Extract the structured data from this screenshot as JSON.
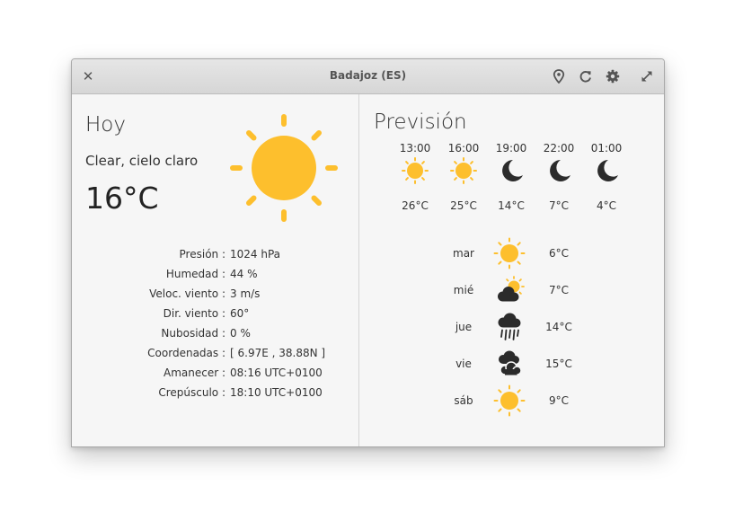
{
  "window": {
    "title": "Badajoz (ES)"
  },
  "titlebar_icons": [
    "close-icon",
    "location-pin-icon",
    "refresh-icon",
    "gear-icon",
    "maximize-icon"
  ],
  "colors": {
    "sun": "#FDBF2D",
    "dark_icon": "#2b2b2b"
  },
  "today": {
    "heading": "Hoy",
    "description": "Clear, cielo claro",
    "temperature": "16°C",
    "icon": "sun-icon",
    "details": [
      {
        "label": "Presión :",
        "value": "1024 hPa"
      },
      {
        "label": "Humedad :",
        "value": "44 %"
      },
      {
        "label": "Veloc. viento :",
        "value": "3 m/s"
      },
      {
        "label": "Dir. viento :",
        "value": "60°"
      },
      {
        "label": "Nubosidad :",
        "value": "0 %"
      },
      {
        "label": "Coordenadas :",
        "value": "[ 6.97E , 38.88N ]"
      },
      {
        "label": "Amanecer :",
        "value": "08:16 UTC+0100"
      },
      {
        "label": "Crepúsculo :",
        "value": "18:10 UTC+0100"
      }
    ]
  },
  "forecast": {
    "heading": "Previsión",
    "hourly": [
      {
        "time": "13:00",
        "icon": "sun-icon",
        "temp": "26°C"
      },
      {
        "time": "16:00",
        "icon": "sun-icon",
        "temp": "25°C"
      },
      {
        "time": "19:00",
        "icon": "moon-icon",
        "temp": "14°C"
      },
      {
        "time": "22:00",
        "icon": "moon-icon",
        "temp": "7°C"
      },
      {
        "time": "01:00",
        "icon": "moon-icon",
        "temp": "4°C"
      }
    ],
    "daily": [
      {
        "day": "mar",
        "icon": "sun-icon",
        "temp": "6°C"
      },
      {
        "day": "mié",
        "icon": "sun-behind-cloud-icon",
        "temp": "7°C"
      },
      {
        "day": "jue",
        "icon": "rain-cloud-icon",
        "temp": "14°C"
      },
      {
        "day": "vie",
        "icon": "clouds-icon",
        "temp": "15°C"
      },
      {
        "day": "sáb",
        "icon": "sun-icon",
        "temp": "9°C"
      }
    ]
  }
}
